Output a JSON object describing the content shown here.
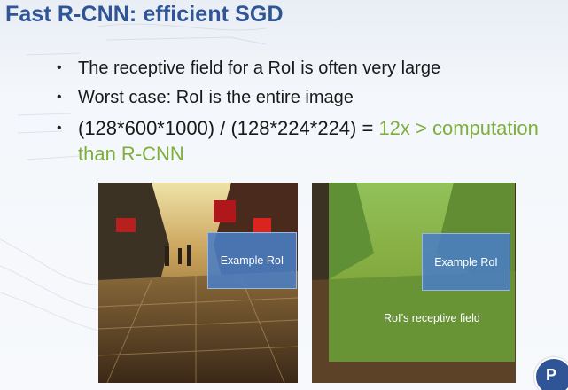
{
  "slide": {
    "title": "Fast R-CNN: efficient SGD",
    "bullets": [
      "The receptive field for a RoI is often very large",
      "Worst case: RoI is the entire image"
    ],
    "formula_bullet": {
      "text": "(128*600*1000) / (128*224*224) = ",
      "highlight": "12x > computation than R-CNN",
      "highlight_color": "#7fae3d"
    },
    "left_image": {
      "roi_label": "Example RoI"
    },
    "right_image": {
      "roi_label": "Example RoI",
      "field_label": "RoI’s receptive field"
    },
    "logo": {
      "letter": "P"
    },
    "colors": {
      "title": "#2f5597",
      "roi_box": "#4a7ec4",
      "receptive_field": "#6eb43c"
    },
    "icons": {
      "bullet": "bullet-dot-icon",
      "logo": "logo-icon"
    }
  }
}
